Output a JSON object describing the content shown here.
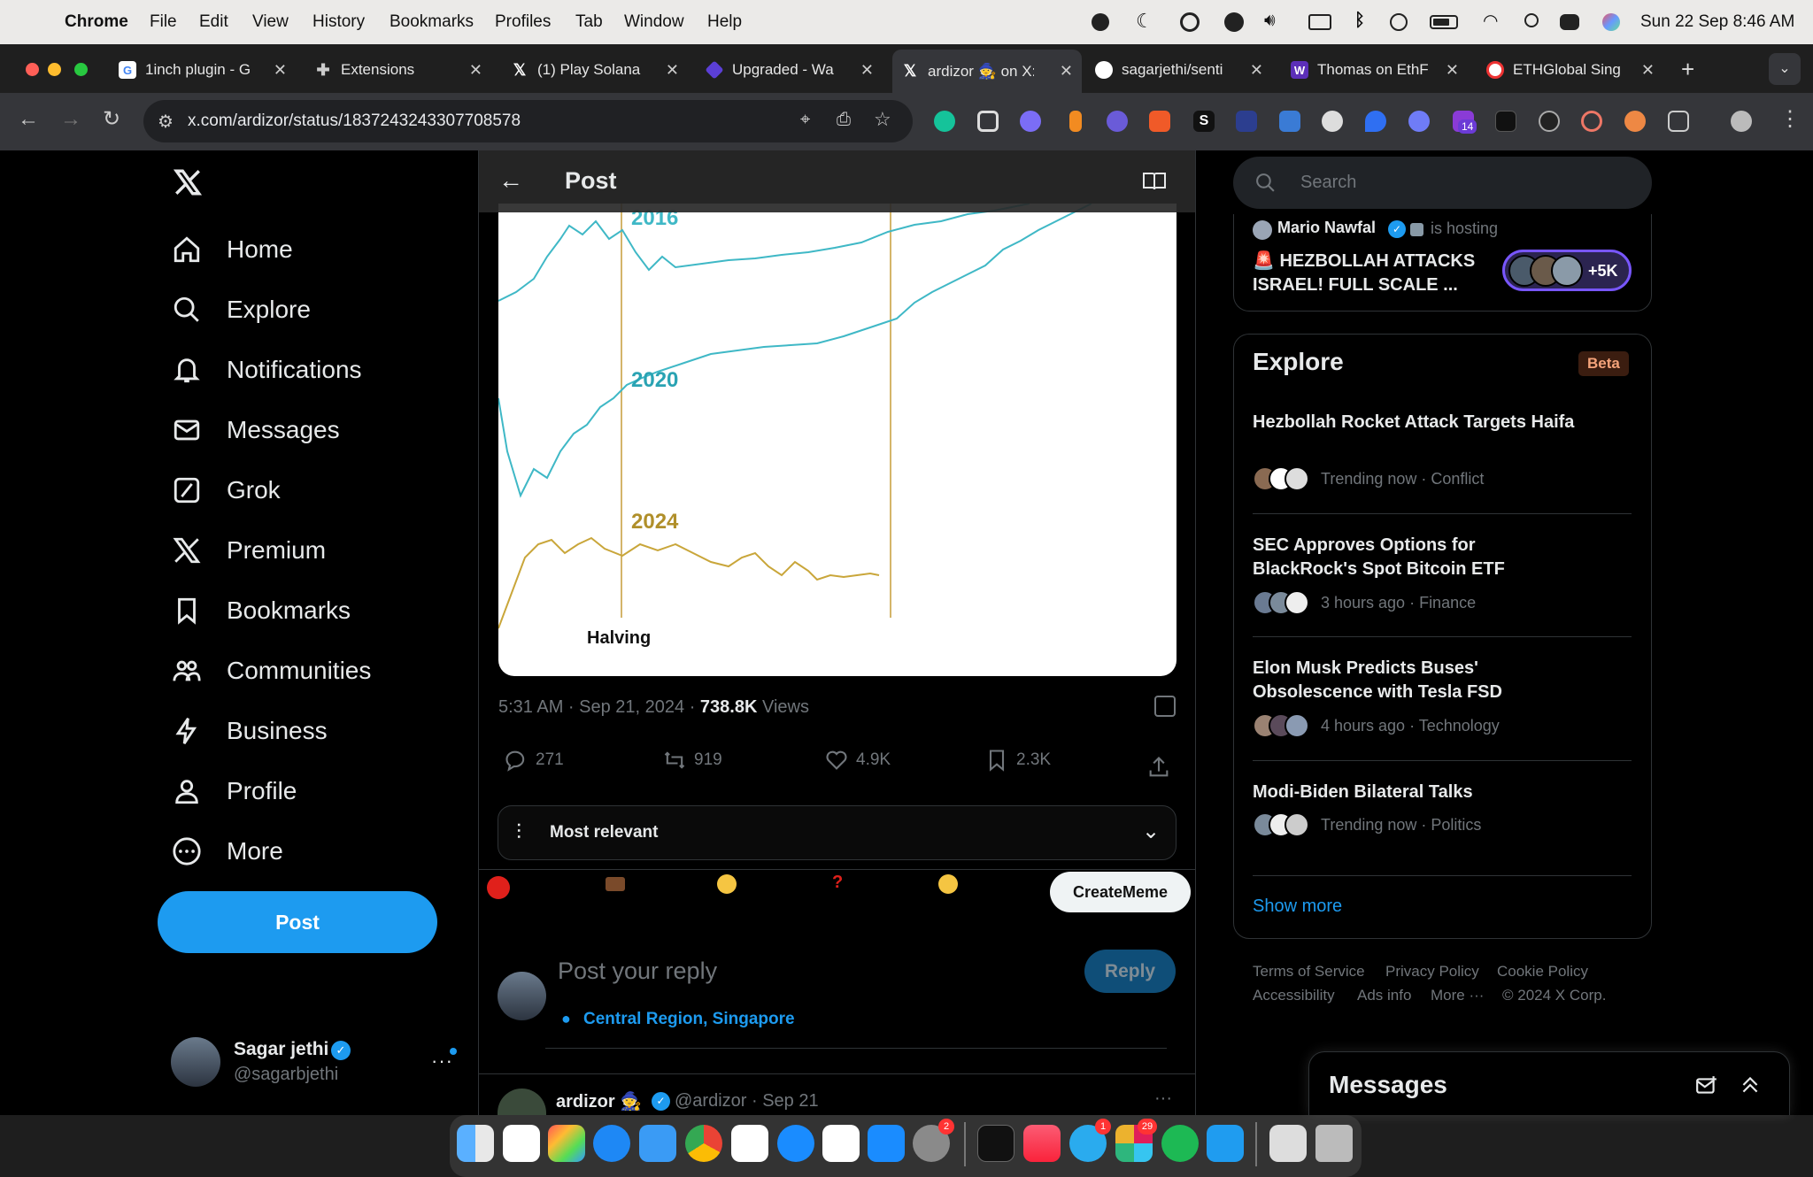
{
  "menubar": {
    "app": "Chrome",
    "items": [
      "File",
      "Edit",
      "View",
      "History",
      "Bookmarks",
      "Profiles",
      "Tab",
      "Window",
      "Help"
    ],
    "datetime": "Sun 22 Sep  8:46 AM"
  },
  "tabs": [
    {
      "title": "1inch plugin - G",
      "icon": "google-icon"
    },
    {
      "title": "Extensions",
      "icon": "puzzle-icon"
    },
    {
      "title": "(1) Play Solana",
      "icon": "x-logo-icon"
    },
    {
      "title": "Upgraded - Wa",
      "icon": "diamond-icon"
    },
    {
      "title": "ardizor 🧙 on X:",
      "icon": "x-logo-icon"
    },
    {
      "title": "sagarjethi/senti",
      "icon": "github-icon"
    },
    {
      "title": "Thomas on EthF",
      "icon": "w-icon"
    },
    {
      "title": "ETHGlobal Sing",
      "icon": "globe-icon"
    }
  ],
  "url": "x.com/ardizor/status/1837243243307708578",
  "ext_badge": "14",
  "nav": {
    "items": [
      "Home",
      "Explore",
      "Notifications",
      "Messages",
      "Grok",
      "Premium",
      "Bookmarks",
      "Communities",
      "Business",
      "Profile",
      "More"
    ],
    "post_button": "Post",
    "user_name": "Sagar jethi",
    "user_handle": "@sagarbjethi"
  },
  "header": {
    "title": "Post"
  },
  "chart_labels": {
    "y2016": "2016",
    "y2020": "2020",
    "y2024": "2024",
    "halving": "Halving"
  },
  "tweet": {
    "time": "5:31 AM · Sep 21, 2024 · ",
    "views_count": "738.8K",
    "views_label": " Views",
    "replies": "271",
    "reposts": "919",
    "likes": "4.9K",
    "bookmarks": "2.3K"
  },
  "sort": {
    "label": "Most relevant"
  },
  "meme_button": "CreateMeme",
  "reply": {
    "placeholder": "Post your reply",
    "location": "Central Region, Singapore",
    "button": "Reply"
  },
  "next_reply": {
    "name": "ardizor 🧙",
    "handle": "@ardizor · Sep 21"
  },
  "search": {
    "placeholder": "Search"
  },
  "space": {
    "host": "Mario Nawfal",
    "hosting": "is hosting",
    "title": "🚨 HEZBOLLAH ATTACKS ISRAEL! FULL SCALE ...",
    "listeners": "+5K"
  },
  "explore": {
    "title": "Explore",
    "badge": "Beta",
    "trends": [
      {
        "title": "Hezbollah Rocket Attack Targets Haifa",
        "sub": "Trending now · Conflict"
      },
      {
        "title": "SEC Approves Options for BlackRock's Spot Bitcoin ETF",
        "sub": "3 hours ago · Finance"
      },
      {
        "title": "Elon Musk Predicts Buses' Obsolescence with Tesla FSD",
        "sub": "4 hours ago · Technology"
      },
      {
        "title": "Modi-Biden Bilateral Talks",
        "sub": "Trending now · Politics"
      }
    ],
    "show_more": "Show more"
  },
  "footer": {
    "l1": [
      "Terms of Service",
      "Privacy Policy",
      "Cookie Policy"
    ],
    "l2": [
      "Accessibility",
      "Ads info",
      "More ···",
      "© 2024 X Corp."
    ]
  },
  "messages_drawer": {
    "title": "Messages"
  },
  "dock_badges": {
    "settings": "2",
    "telegram": "1",
    "slack": "29"
  },
  "colors": {
    "accent": "#1d9bf0",
    "x_bg": "#000000",
    "chart_teal": "#3fb8c6",
    "chart_gold": "#c9a63a"
  }
}
